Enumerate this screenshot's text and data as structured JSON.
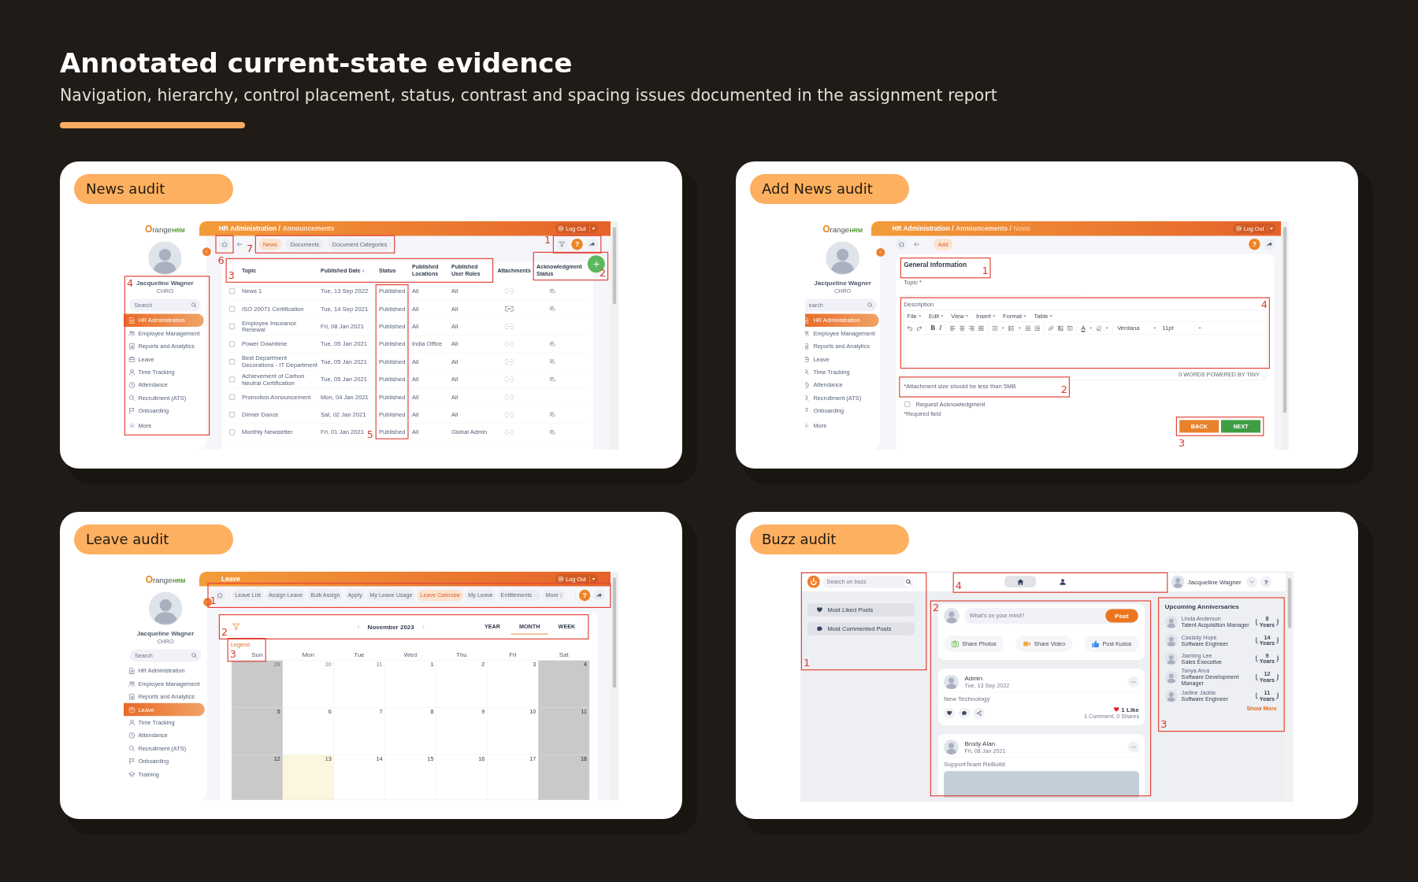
{
  "header": {
    "title": "Annotated current-state evidence",
    "subtitle": "Navigation, hierarchy, control placement, status, contrast and spacing issues documented in the assignment report"
  },
  "panels": [
    {
      "kind": "news",
      "label": "News audit",
      "screen": {
        "sidebar": {
          "logo": {
            "main": "Orange",
            "accent": "HRM"
          },
          "name": "Jacqueline Wagner",
          "role": "CHRO",
          "annotation": "4",
          "search": {
            "placeholder": "Search"
          },
          "menu": [
            {
              "label": "HR Administration",
              "selected": true
            },
            {
              "label": "Employee Management",
              "selected": false
            },
            {
              "label": "Reports and Analytics",
              "selected": false
            },
            {
              "label": "Leave",
              "selected": false
            },
            {
              "label": "Time Tracking",
              "selected": false
            },
            {
              "label": "Attendance",
              "selected": false
            },
            {
              "label": "Recruitment (ATS)",
              "selected": false
            },
            {
              "label": "Onboarding",
              "selected": false
            }
          ],
          "more": "More"
        },
        "breadcrumb": [
          "HR Administration /",
          "Announcements"
        ],
        "logout": "Log Out",
        "help": "?",
        "home_annotation": "6",
        "tabs_annotation": "7",
        "actions_annotation": "1",
        "tabs": [
          {
            "label": "News",
            "selected": true
          },
          {
            "label": "Documents",
            "selected": false
          },
          {
            "label": "Document Categories",
            "selected": false
          }
        ],
        "table": {
          "header_annotation": "3",
          "columns": [
            {
              "kind": "text",
              "label": "Topic",
              "sorted": false
            },
            {
              "kind": "text",
              "label": "Published Date",
              "sorted": true
            },
            {
              "kind": "text",
              "label": "Status",
              "sorted": false,
              "cells_annotation": "5"
            },
            {
              "kind": "text",
              "label": "Published Locations",
              "sorted": false
            },
            {
              "kind": "text",
              "label": "Published User Roles",
              "sorted": false
            },
            {
              "kind": "attachment",
              "label": "Attachments",
              "sorted": false
            },
            {
              "kind": "acknowledgment",
              "label": "Acknowledgment Status",
              "sorted": false
            }
          ],
          "rows": [
            {
              "checked": false,
              "cells": [
                "News 1",
                "Tue, 13 Sep 2022",
                "Published",
                "All",
                "All"
              ],
              "attachment": false,
              "acknowledgment": true
            },
            {
              "checked": false,
              "cells": [
                "ISO 20071 Certification",
                "Tue, 14 Sep 2021",
                "Published",
                "All",
                "All"
              ],
              "attachment": true,
              "acknowledgment": true
            },
            {
              "checked": false,
              "cells": [
                "Employee Insurance Renewal",
                "Fri, 08 Jan 2021",
                "Published",
                "All",
                "All"
              ],
              "attachment": false,
              "acknowledgment": false
            },
            {
              "checked": false,
              "cells": [
                "Power Downtime",
                "Tue, 05 Jan 2021",
                "Published",
                "India Office",
                "All"
              ],
              "attachment": false,
              "acknowledgment": true
            },
            {
              "checked": false,
              "cells": [
                "Best Department Decorations - IT Department",
                "Tue, 05 Jan 2021",
                "Published",
                "All",
                "All"
              ],
              "attachment": false,
              "acknowledgment": true
            },
            {
              "checked": false,
              "cells": [
                "Achievement of Carbon Neutral Certification",
                "Tue, 05 Jan 2021",
                "Published",
                "All",
                "All"
              ],
              "attachment": false,
              "acknowledgment": true
            },
            {
              "checked": false,
              "cells": [
                "Promotion Announcement",
                "Mon, 04 Jan 2021",
                "Published",
                "All",
                "All"
              ],
              "attachment": false,
              "acknowledgment": false
            },
            {
              "checked": false,
              "cells": [
                "Dinner Dance",
                "Sat, 02 Jan 2021",
                "Published",
                "All",
                "All"
              ],
              "attachment": false,
              "acknowledgment": true
            },
            {
              "checked": false,
              "cells": [
                "Monthly Newsletter",
                "Fri, 01 Jan 2021",
                "Published",
                "All",
                "Global Admin"
              ],
              "attachment": false,
              "acknowledgment": true
            }
          ]
        },
        "add_button": {
          "annotation": "2"
        }
      }
    },
    {
      "kind": "add_news",
      "label": "Add News audit",
      "screen": {
        "sidebar": {
          "logo": {
            "main": "Orange",
            "accent": "HRM"
          },
          "name": "Jacqueline Wagner",
          "role": "CHRO",
          "search": {
            "placeholder": "earch"
          },
          "menu": [
            {
              "label": "HR Administration",
              "selected": true
            },
            {
              "label": "Employee Management",
              "selected": false
            },
            {
              "label": "Reports and Analytics",
              "selected": false
            },
            {
              "label": "Leave",
              "selected": false
            },
            {
              "label": "Time Tracking",
              "selected": false
            },
            {
              "label": "Attendance",
              "selected": false
            },
            {
              "label": "Recruitment (ATS)",
              "selected": false
            },
            {
              "label": "Onboarding",
              "selected": false
            }
          ],
          "more": "More"
        },
        "breadcrumb": [
          "HR Administration /",
          "Announcements /",
          "News"
        ],
        "logout": "Log Out",
        "help": "?",
        "tabs": [
          {
            "label": "Add",
            "selected": true
          }
        ],
        "form": {
          "section": {
            "title": "General Information",
            "annotation": "1"
          },
          "topic": {
            "label": "Topic *"
          },
          "description": {
            "label": "Description",
            "annotation": "4",
            "menus": [
              "File",
              "Edit",
              "View",
              "Insert",
              "Format",
              "Table"
            ],
            "bold": "B",
            "italic": "I",
            "text_color": "A",
            "font": "Verdana",
            "size": "11pt",
            "status": "0 WORDS POWERED BY TINY"
          },
          "note": {
            "text": "*Attachment size should be less than 5MB",
            "annotation": "2"
          },
          "acknowledge": {
            "label": "Request Acknowledgment",
            "checked": false
          },
          "required": "*Required field",
          "buttons": {
            "annotation": "3",
            "items": [
              {
                "kind": "back",
                "label": "BACK"
              },
              {
                "kind": "next",
                "label": "NEXT"
              }
            ]
          }
        }
      }
    },
    {
      "kind": "leave",
      "label": "Leave audit",
      "screen": {
        "sidebar": {
          "logo": {
            "main": "Orange",
            "accent": "HRM"
          },
          "name": "Jacqueline Wagner",
          "role": "CHRO",
          "search": {
            "placeholder": "Search"
          },
          "menu": [
            {
              "label": "HR Administration",
              "selected": false
            },
            {
              "label": "Employee Management",
              "selected": false
            },
            {
              "label": "Reports and Analytics",
              "selected": false
            },
            {
              "label": "Leave",
              "selected": true
            },
            {
              "label": "Time Tracking",
              "selected": false
            },
            {
              "label": "Attendance",
              "selected": false
            },
            {
              "label": "Recruitment (ATS)",
              "selected": false
            },
            {
              "label": "Onboarding",
              "selected": false
            },
            {
              "label": "Training",
              "selected": false
            }
          ]
        },
        "breadcrumb": [
          "Leave"
        ],
        "logout": "Log Out",
        "help": "?",
        "toolbar_annotation": "1",
        "tabs": [
          {
            "label": "Leave List",
            "kind": "plain",
            "selected": false
          },
          {
            "label": "Assign Leave",
            "kind": "plain",
            "selected": false
          },
          {
            "label": "Bulk Assign",
            "kind": "plain",
            "selected": false
          },
          {
            "label": "Apply",
            "kind": "plain",
            "selected": false
          },
          {
            "label": "My Leave Usage",
            "kind": "plain",
            "selected": false
          },
          {
            "label": "Leave Calendar",
            "kind": "plain",
            "selected": true
          },
          {
            "label": "My Leave",
            "kind": "plain",
            "selected": false
          },
          {
            "label": "Entitlements",
            "kind": "dropdown",
            "selected": false
          },
          {
            "label": "More",
            "kind": "overflow",
            "selected": false
          }
        ],
        "calendar": {
          "annotation": "2",
          "month": "November 2023",
          "views": [
            {
              "label": "YEAR",
              "selected": false
            },
            {
              "label": "MONTH",
              "selected": true
            },
            {
              "label": "WEEK",
              "selected": false
            }
          ],
          "legend": {
            "label": "Legend",
            "annotation": "3"
          },
          "days": [
            {
              "label": "Sun",
              "weekend": true
            },
            {
              "label": "Mon",
              "weekend": false
            },
            {
              "label": "Tue",
              "weekend": false
            },
            {
              "label": "Wed",
              "weekend": false
            },
            {
              "label": "Thu",
              "weekend": false
            },
            {
              "label": "Fri",
              "weekend": false
            },
            {
              "label": "Sat",
              "weekend": true
            }
          ],
          "weeks": [
            [
              {
                "date": "29",
                "outside": true,
                "today": false
              },
              {
                "date": "30",
                "outside": true,
                "today": false
              },
              {
                "date": "31",
                "outside": true,
                "today": false
              },
              {
                "date": "1",
                "outside": false,
                "today": false
              },
              {
                "date": "2",
                "outside": false,
                "today": false
              },
              {
                "date": "3",
                "outside": false,
                "today": false
              },
              {
                "date": "4",
                "outside": false,
                "today": false
              }
            ],
            [
              {
                "date": "5",
                "outside": false,
                "today": false
              },
              {
                "date": "6",
                "outside": false,
                "today": false
              },
              {
                "date": "7",
                "outside": false,
                "today": false
              },
              {
                "date": "8",
                "outside": false,
                "today": false
              },
              {
                "date": "9",
                "outside": false,
                "today": false
              },
              {
                "date": "10",
                "outside": false,
                "today": false
              },
              {
                "date": "11",
                "outside": false,
                "today": false
              }
            ],
            [
              {
                "date": "12",
                "outside": false,
                "today": false
              },
              {
                "date": "13",
                "outside": false,
                "today": true
              },
              {
                "date": "14",
                "outside": false,
                "today": false
              },
              {
                "date": "15",
                "outside": false,
                "today": false
              },
              {
                "date": "16",
                "outside": false,
                "today": false
              },
              {
                "date": "17",
                "outside": false,
                "today": false
              },
              {
                "date": "18",
                "outside": false,
                "today": false
              }
            ]
          ]
        }
      }
    },
    {
      "kind": "buzz",
      "label": "Buzz audit",
      "screen": {
        "search": {
          "placeholder": "Search on buzz"
        },
        "nav": {
          "annotation": "4",
          "items": [
            {
              "selected": true
            },
            {
              "selected": false
            }
          ]
        },
        "user": {
          "name": "Jacqueline Wagner"
        },
        "help": "?",
        "filters": {
          "annotation": "1",
          "items": [
            {
              "label": "Most Liked Posts"
            },
            {
              "label": "Most Commented Posts"
            }
          ]
        },
        "feed": {
          "annotation": "2",
          "composer": {
            "placeholder": "What's on your mind?",
            "button": "Post",
            "actions": [
              "Share Photos",
              "Share Video",
              "Post Kudos"
            ]
          },
          "posts": [
            {
              "author": "Admin",
              "date": "Tue, 13 Sep 2022",
              "text": "New Technology",
              "photo": false,
              "likes": "1 Like",
              "stats": "1 Comment, 0 Shares"
            },
            {
              "author": "Brody Alan",
              "date": "Fri, 08 Jan 2021",
              "text": "SupportTeam ReBuild",
              "photo": true
            }
          ]
        },
        "anniversaries": {
          "annotation": "3",
          "title": "Upcoming Anniversaries",
          "people": [
            {
              "name": "Linda Anderson",
              "title": "Talent Acquisition Manager",
              "years": "8",
              "unit": "Years"
            },
            {
              "name": "Cassidy Hope",
              "title": "Software Engineer",
              "years": "14",
              "unit": "Years"
            },
            {
              "name": "Jiaming Lee",
              "title": "Sales Executive",
              "years": "9",
              "unit": "Years"
            },
            {
              "name": "Tanya Arva",
              "title": "Software Development Manager",
              "years": "12",
              "unit": "Years"
            },
            {
              "name": "Jadine Jackie",
              "title": "Software Engineer",
              "years": "11",
              "unit": "Years"
            }
          ],
          "more": "Show More"
        }
      }
    }
  ]
}
